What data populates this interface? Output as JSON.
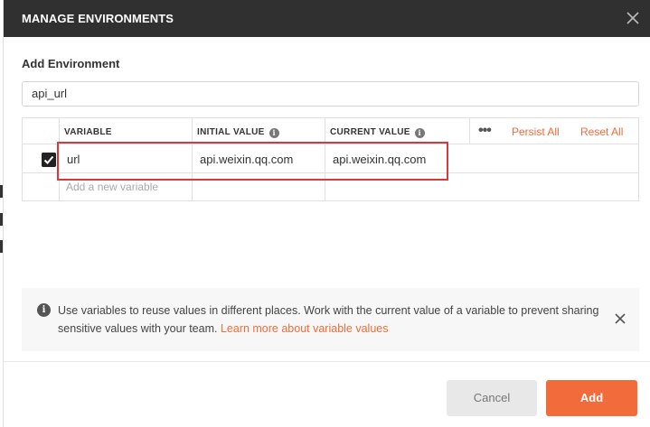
{
  "header": {
    "title": "MANAGE ENVIRONMENTS"
  },
  "form": {
    "section_label": "Add Environment",
    "name_value": "api_url"
  },
  "table": {
    "col_variable": "VARIABLE",
    "col_initial": "INITIAL VALUE",
    "col_current": "CURRENT VALUE",
    "more_label": "•••",
    "persist_all": "Persist All",
    "reset_all": "Reset All",
    "rows": [
      {
        "checked": true,
        "variable": "url",
        "initial_value": "api.weixin.qq.com",
        "current_value": "api.weixin.qq.com"
      }
    ],
    "add_placeholder": "Add a new variable"
  },
  "info": {
    "text": "Use variables to reuse values in different places. Work with the current value of a variable to prevent sharing sensitive values with your team. ",
    "link": "Learn more about variable values"
  },
  "footer": {
    "cancel_label": "Cancel",
    "add_label": "Add"
  },
  "colors": {
    "accent": "#f26b3a",
    "header_bg": "#303030",
    "highlight": "#d9383c"
  }
}
